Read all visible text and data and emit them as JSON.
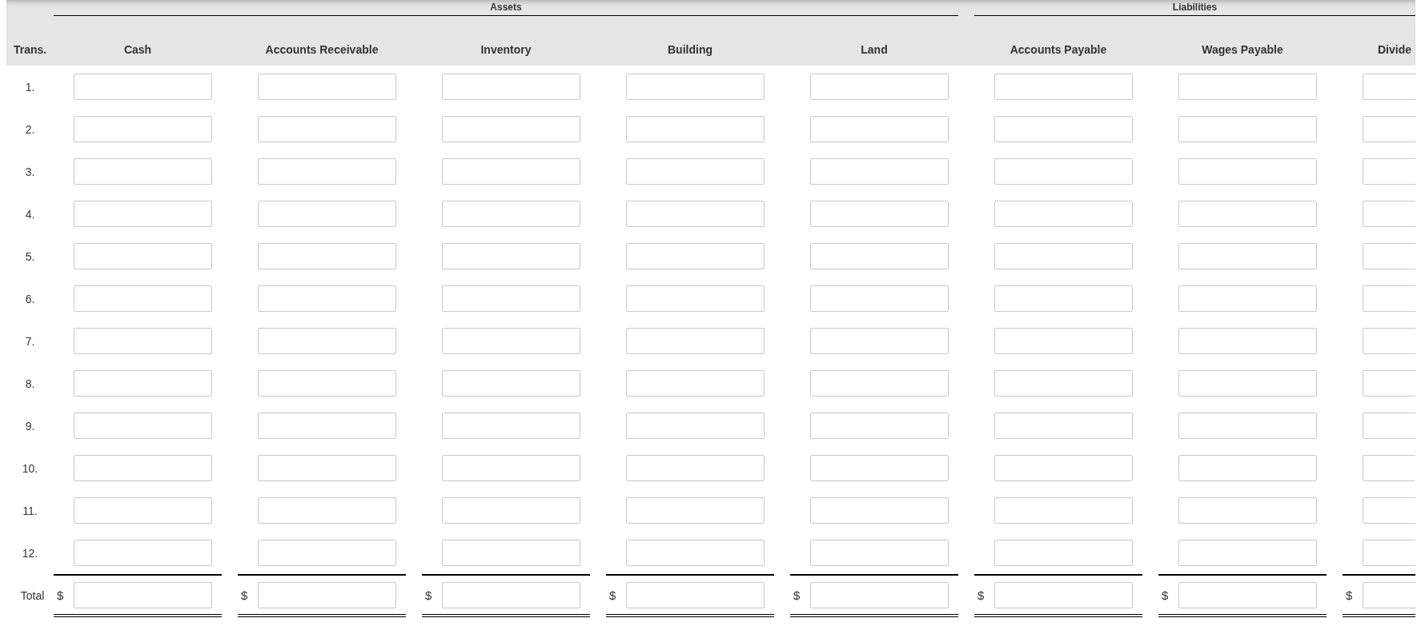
{
  "trans_header": "Trans.",
  "groups": [
    {
      "label": "Assets",
      "columns": [
        "Cash",
        "Accounts Receivable",
        "Inventory",
        "Building",
        "Land"
      ]
    },
    {
      "label": "Liabilities",
      "columns": [
        "Accounts Payable",
        "Wages Payable",
        "Divide"
      ]
    }
  ],
  "rows": [
    "1.",
    "2.",
    "3.",
    "4.",
    "5.",
    "6.",
    "7.",
    "8.",
    "9.",
    "10.",
    "11.",
    "12."
  ],
  "total": {
    "label": "Total",
    "currency_signs": [
      "$",
      "$",
      "$",
      "$",
      "$",
      "$",
      "$",
      "$"
    ]
  }
}
